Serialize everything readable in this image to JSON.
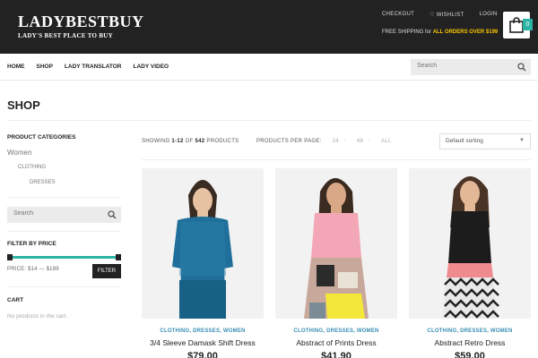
{
  "brand": {
    "name": "LADYBESTBUY",
    "tagline": "LADY'S BEST PLACE TO BUY"
  },
  "top_links": [
    {
      "label": "CHECKOUT"
    },
    {
      "label": "♡ WISHLIST"
    },
    {
      "label": "LOGIN"
    }
  ],
  "shipping": {
    "text": "FREE SHIPPING for ",
    "highlight": "ALL ORDERS OVER $199"
  },
  "cart": {
    "count": "0",
    "icon": "shopping-bag-icon"
  },
  "nav": {
    "items": [
      "HOME",
      "SHOP",
      "LADY TRANSLATOR",
      "LADY VIDEO"
    ]
  },
  "search": {
    "placeholder": "Search",
    "icon": "search-icon"
  },
  "page_title": "SHOP",
  "sidebar": {
    "categories_heading": "PRODUCT CATEGORIES",
    "categories": [
      "Women",
      "CLOTHING",
      "DRESSES"
    ],
    "search_placeholder": "Search",
    "price_heading": "FILTER BY PRICE",
    "price_label": "PRICE: $14 — $189",
    "price_range": {
      "min": 14,
      "max": 189
    },
    "filter_label": "FILTER",
    "cart_heading": "CART",
    "cart_empty": "No products in the cart."
  },
  "toolbar": {
    "showing_prefix": "SHOWING ",
    "showing_range": "1-12",
    "showing_of": " OF ",
    "showing_total": "542",
    "showing_suffix": " PRODUCTS",
    "per_page_label": "PRODUCTS PER PAGE:",
    "per_page_options": [
      "24",
      "48",
      "ALL"
    ],
    "sort_selected": "Default sorting"
  },
  "products": [
    {
      "categories": "CLOTHING, DRESSES, WOMEN",
      "name": "3/4 Sleeve Damask Shift Dress",
      "price": "$79.00"
    },
    {
      "categories": "CLOTHING, DRESSES, WOMEN",
      "name": "Abstract of Prints Dress",
      "price": "$41.90"
    },
    {
      "categories": "CLOTHING, DRESSES, WOMEN",
      "name": "Abstract Retro Dress",
      "price": "$59.00"
    }
  ],
  "colors": {
    "topbar": "#222222",
    "accent": "#2ab5a5",
    "highlight": "#f7c600",
    "category_link": "#3a8fb5"
  }
}
